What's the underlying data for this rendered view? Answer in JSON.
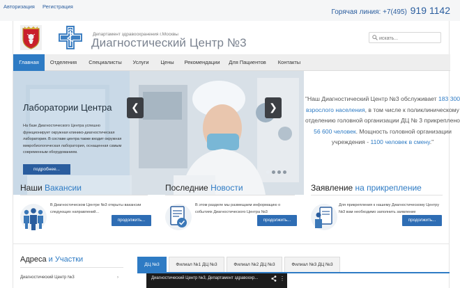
{
  "top": {
    "links": [
      "Авторизация",
      "Регистрация"
    ],
    "hotline_label": "Горячая линия:",
    "hotline_code": "+7(495)",
    "hotline_number": "919 1142"
  },
  "header": {
    "department": "Департамент здравоохранения г.Москвы",
    "title": "Диагностический Центр №3",
    "search_placeholder": "искать..."
  },
  "nav": {
    "items": [
      "Главная",
      "Отделения",
      "Специалисты",
      "Услуги",
      "Цены",
      "Рекомендации",
      "Для Пациентов",
      "Контакты"
    ],
    "active_index": 0
  },
  "slider": {
    "caption_title": "Лаборатории Центра",
    "caption_text": "На базе Диагностического Центра успешно функционирует окружная клинико-диагностическая лаборатория. В составе центра также входит окружная микробиологическая лаборатория, оснащенная самым современным оборудованием.",
    "more_label": "подробнее...",
    "prev_label": "❮",
    "next_label": "❯",
    "slide_count": 4,
    "active_slide": 0
  },
  "quote": {
    "p1": "\"Наш Диагностический Центр №3 обслуживает ",
    "h1": "183 300 взрослого населения",
    "p2": ", в том числе к поликлиническому отделению головной организации ДЦ № 3 прикреплено ",
    "h2": "56 600 человек",
    "p3": ". Мощность головной организации учреждения - ",
    "h3": "1100 человек в смену",
    "p4": ".\""
  },
  "blocks": [
    {
      "title_a": "Наши ",
      "title_b": "Вакансии",
      "text": "В Диагностическом Центре №3 открыты вакансии следующих направлений...",
      "button": "продолжить..."
    },
    {
      "title_a": "Последние ",
      "title_b": "Новости",
      "text": "В этом разделе мы размещаем информацию о событиях Диагностического Центра №3",
      "button": "продолжить..."
    },
    {
      "title_a": "Заявление ",
      "title_b": "на прикрепление",
      "text": "Для прикрепления к нашему Диагностическому Центру №3 вам необходимо заполнить заявление",
      "button": "продолжить..."
    }
  ],
  "addresses": {
    "title_a": "Адреса ",
    "title_b": "и Участки",
    "item": "Диагностический Центр №3",
    "item_arrow": "›"
  },
  "tabs": [
    "ДЦ №3",
    "Филиал №1 ДЦ №3",
    "Филиал №2 ДЦ №3",
    "Филиал №3 ДЦ №3"
  ],
  "video": {
    "title": "Диагностический Центр №3, Департамент здравоохр...",
    "menu_icon": "⋮"
  },
  "colors": {
    "accent": "#2e7bc4",
    "button": "#2e6db4",
    "nav_bg": "#eeeeee"
  }
}
